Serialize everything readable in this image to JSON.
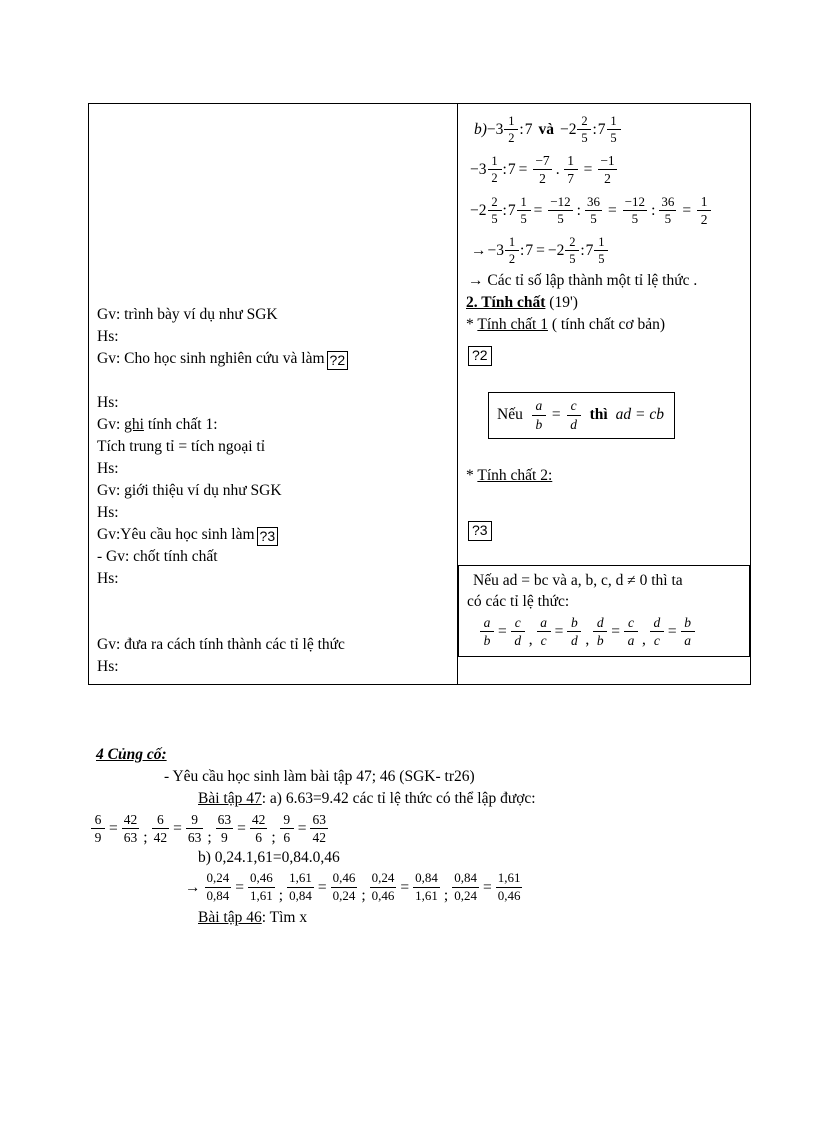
{
  "document": {
    "language": "vi",
    "type": "lesson-plan"
  },
  "table": {
    "left_column": {
      "lines": [
        "Gv: trình bày ví dụ như SGK",
        "Hs:",
        "Gv: Cho học sinh nghiên cứu và làm",
        "",
        "Hs:",
        "Gv: ghi tính chất 1:",
        "Tích trung tỉ = tích ngoại tỉ",
        "Hs:",
        "Gv: giới thiệu ví dụ như SGK",
        "Hs:",
        "Gv:Yêu cầu học sinh làm",
        "-  Gv: chốt tính chất",
        "Hs:",
        "Gv: đưa ra cách tính thành các tỉ lệ thức",
        "Hs:"
      ],
      "marker_after_line3": "?2",
      "marker_after_line11": "?3",
      "ghi_prefix": "Gv: ",
      "ghi_underlined": "ghi",
      "ghi_rest": " tính chất 1:"
    },
    "right_column": {
      "problem_b_label": "b)",
      "line_b": {
        "mixed1": {
          "sign": "−",
          "whole": "3",
          "num": "1",
          "den": "2"
        },
        "divider": ":",
        "rhs1": "7",
        "va": "và",
        "mixed2": {
          "sign": "−",
          "whole": "2",
          "num": "2",
          "den": "5"
        },
        "mixed3": {
          "whole": "7",
          "num": "1",
          "den": "5"
        }
      },
      "calc1": {
        "lhs": {
          "sign": "−",
          "whole": "3",
          "num": "1",
          "den": "2"
        },
        "colon": ":",
        "seven": "7",
        "eq": "=",
        "f1": {
          "num": "−7",
          "den": "2"
        },
        "dot": ".",
        "f2": {
          "num": "1",
          "den": "7"
        },
        "eq2": "=",
        "f3": {
          "num": "−1",
          "den": "2"
        }
      },
      "calc2": {
        "lhs": {
          "sign": "−",
          "whole": "2",
          "num": "2",
          "den": "5"
        },
        "colon": ":",
        "rhs": {
          "whole": "7",
          "num": "1",
          "den": "5"
        },
        "eq": "=",
        "f1": {
          "num": "−12",
          "den": "5"
        },
        "div": ":",
        "f2": {
          "num": "36",
          "den": "5"
        },
        "eq2": "=",
        "f3": {
          "num": "−12",
          "den": "5"
        },
        "div2": ":",
        "f4": {
          "num": "36",
          "den": "5"
        },
        "eq3": "=",
        "f5": {
          "num": "1",
          "den": "2"
        }
      },
      "calc3": {
        "arrow": "→",
        "lhs": {
          "sign": "−",
          "whole": "3",
          "num": "1",
          "den": "2"
        },
        "colon": ":",
        "seven": "7",
        "eq": "=",
        "rhs1": {
          "sign": "−",
          "whole": "2",
          "num": "2",
          "den": "5"
        },
        "colon2": ":",
        "rhs2": {
          "whole": "7",
          "num": "1",
          "den": "5"
        }
      },
      "conclusion": "→ Các tỉ số lập thành một tỉ lệ thức .",
      "section_number": "2. Tính chất",
      "section_time": "(19')",
      "property1_star": "*",
      "property1_title": "Tính chất 1",
      "property1_note": "( tính chất cơ bản)",
      "marker2": "?2",
      "formula1": {
        "if": "Nếu",
        "left": {
          "num": "a",
          "den": "b"
        },
        "eq": "=",
        "right": {
          "num": "c",
          "den": "d"
        },
        "then": "thì",
        "result": "ad = cb"
      },
      "property2_star": "*",
      "property2_title": "Tính chất 2:",
      "marker3": "?3",
      "bottom_box": {
        "line1": "Nếu ad = bc và a, b, c, d ≠ 0 thì ta",
        "line2": "có các tỉ lệ thức:",
        "fractions": [
          {
            "num": "a",
            "den": "b",
            "eq": "=",
            "num2": "c",
            "den2": "d",
            "sep": ","
          },
          {
            "num": "a",
            "den": "c",
            "eq": "=",
            "num2": "b",
            "den2": "d",
            "sep": ","
          },
          {
            "num": "d",
            "den": "b",
            "eq": "=",
            "num2": "c",
            "den2": "a",
            "sep": ","
          },
          {
            "num": "d",
            "den": "c",
            "eq": "=",
            "num2": "b",
            "den2": "a",
            "sep": ""
          }
        ]
      }
    }
  },
  "section4": {
    "heading": "4 Củng cố:",
    "request": "- Yêu cầu học sinh làm bài tập 47; 46 (SGK- tr26)",
    "ex47": {
      "label": "Bài tập 47",
      "part_a": ": a) 6.63=9.42  các tỉ lệ thức có thể lập được:",
      "fractions_a": [
        {
          "num": "6",
          "den": "9",
          "eq": "=",
          "num2": "42",
          "den2": "63",
          "sep": ";"
        },
        {
          "num": "6",
          "den": "42",
          "eq": "=",
          "num2": "9",
          "den2": "63",
          "sep": ";"
        },
        {
          "num": "63",
          "den": "9",
          "eq": "=",
          "num2": "42",
          "den2": "6",
          "sep": ";"
        },
        {
          "num": "9",
          "den": "6",
          "eq": "=",
          "num2": "63",
          "den2": "42",
          "sep": ""
        }
      ],
      "part_b": "b) 0,24.1,61=0,84.0,46",
      "arrow": "→",
      "fractions_b": [
        {
          "num": "0,24",
          "den": "0,84",
          "eq": "=",
          "num2": "0,46",
          "den2": "1,61",
          "sep": ";"
        },
        {
          "num": "1,61",
          "den": "0,84",
          "eq": "=",
          "num2": "0,46",
          "den2": "0,24",
          "sep": ";"
        },
        {
          "num": "0,24",
          "den": "0,46",
          "eq": "=",
          "num2": "0,84",
          "den2": "1,61",
          "sep": ";"
        },
        {
          "num": "0,84",
          "den": "0,24",
          "eq": "=",
          "num2": "1,61",
          "den2": "0,46",
          "sep": ""
        }
      ]
    },
    "ex46": {
      "label": "Bài tập 46",
      "text": ": Tìm x"
    }
  }
}
